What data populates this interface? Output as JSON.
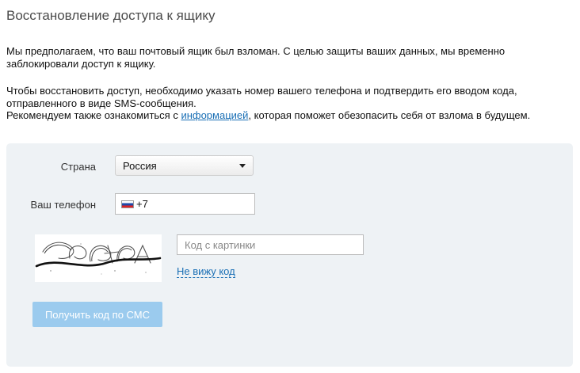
{
  "page": {
    "title": "Восстановление доступа к ящику"
  },
  "intro": {
    "paragraph1": "Мы предполагаем, что ваш почтовый ящик был взломан. С целью защиты ваших данных, мы временно заблокировали доступ к ящику.",
    "paragraph2_line1": "Чтобы восстановить доступ, необходимо указать номер вашего телефона и подтвердить его вводом кода, отправленного в виде SMS-сообщения.",
    "paragraph2_before_link": "Рекомендуем также ознакомиться с ",
    "paragraph2_link": "информацией",
    "paragraph2_after_link": ", которая поможет обезопасить себя от взлома в будущем."
  },
  "form": {
    "country_label": "Страна",
    "country_value": "Россия",
    "phone_label": "Ваш телефон",
    "phone_prefix": "+7",
    "flag_icon": "russia-flag-icon",
    "captcha_text": "acAFDA",
    "captcha_placeholder": "Код с картинки",
    "no_code_link": "Не вижу код",
    "submit_label": "Получить код по СМС",
    "submit_color": "#9bcbee",
    "link_color": "#1a6fb5",
    "panel_color": "#eef2f5"
  }
}
